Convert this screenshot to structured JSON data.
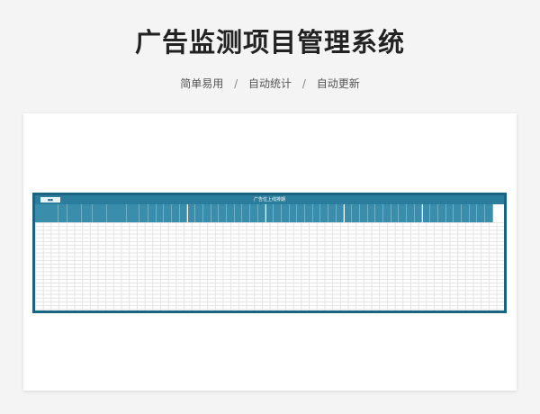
{
  "header": {
    "title": "广告监测项目管理系统",
    "tags": [
      "简单易用",
      "自动统计",
      "自动更新"
    ],
    "separator": "/"
  },
  "sheet": {
    "title": "广告位上线排期",
    "button_label": "■■",
    "colors": {
      "frame": "#1a6483",
      "header": "#3a8eab",
      "accent": "#2a7d9c"
    }
  }
}
